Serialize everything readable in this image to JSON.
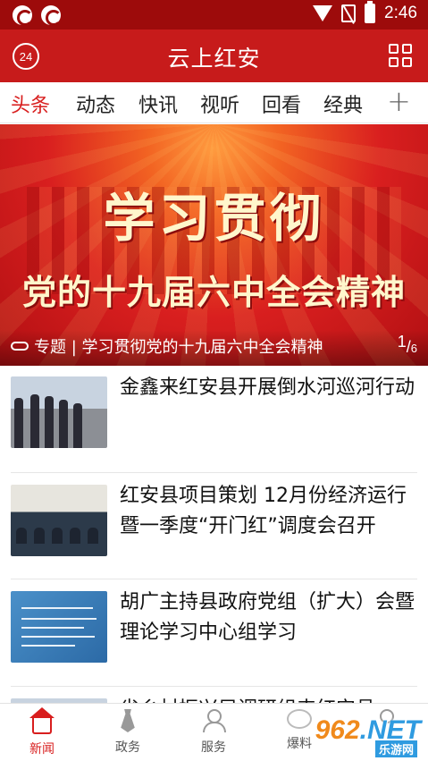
{
  "status_bar": {
    "time": "2:46"
  },
  "header": {
    "badge_number": "24",
    "title": "云上红安"
  },
  "tabs": [
    {
      "label": "头条",
      "active": true
    },
    {
      "label": "动态"
    },
    {
      "label": "快讯"
    },
    {
      "label": "视听"
    },
    {
      "label": "回看"
    },
    {
      "label": "经典"
    }
  ],
  "banner": {
    "heading_line1": "学习贯彻",
    "heading_line2": "党的十九届六中全会精神",
    "caption": "专题 | 学习贯彻党的十九届六中全会精神",
    "pager_current": "1",
    "pager_total": "6"
  },
  "news": [
    {
      "headline": "金鑫来红安县开展倒水河巡河行动"
    },
    {
      "headline": "红安县项目策划 12月份经济运行暨一季度“开门红”调度会召开"
    },
    {
      "headline": "胡广主持县政府党组（扩大）会暨理论学习中心组学习"
    },
    {
      "headline": "省乡村振兴局调研组来红安县"
    }
  ],
  "bottom_nav": [
    {
      "label": "新闻",
      "icon": "home-icon",
      "active": true
    },
    {
      "label": "政务",
      "icon": "tie-icon"
    },
    {
      "label": "服务",
      "icon": "people-icon"
    },
    {
      "label": "爆料",
      "icon": "chat-bubble-icon"
    },
    {
      "label": "我",
      "icon": "user-icon"
    }
  ],
  "watermark": {
    "text_a": "962",
    "text_b": ".NET",
    "sub": "乐游网"
  },
  "colors": {
    "brand_red": "#c71b1b",
    "status_red": "#9d0b0b",
    "active_tab": "#d81e1e"
  }
}
